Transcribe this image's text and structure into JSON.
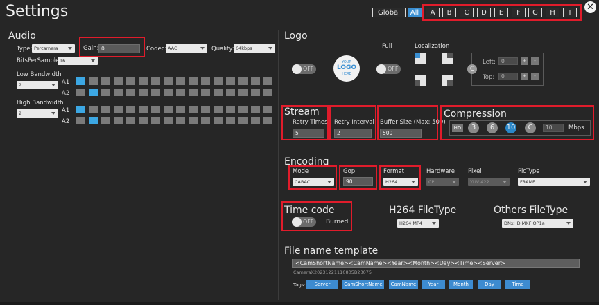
{
  "window": {
    "title": "Settings",
    "close_label": "✕"
  },
  "scope_tabs": {
    "global": "Global",
    "all": "All",
    "cameras": [
      "A",
      "B",
      "C",
      "D",
      "E",
      "F",
      "G",
      "H",
      "I"
    ]
  },
  "audio": {
    "section_title": "Audio",
    "type_label": "Type:",
    "type_value": "Percamera",
    "gain_label": "Gain:",
    "gain_value": "0",
    "codec_label": "Codec:",
    "codec_value": "AAC",
    "quality_label": "Quality:",
    "quality_value": "64kbps",
    "bps_label": "BitsPerSample:",
    "bps_value": "16",
    "low_bw_label": "Low Bandwidth",
    "low_bw_value": "2",
    "high_bw_label": "High Bandwidth",
    "high_bw_value": "2",
    "row_a1": "A1",
    "row_a2": "A2",
    "low_a1_on": 0,
    "low_a2_on": 1,
    "high_a1_on": 0,
    "high_a2_on": 1
  },
  "logo": {
    "section_title": "Logo",
    "toggle_state": "OFF",
    "placeholder_lines": [
      "YOUR",
      "LOGO",
      "HERE"
    ],
    "full_label": "Full",
    "full_state": "OFF",
    "localization_label": "Localization",
    "left_label": "Left:",
    "left_value": "0",
    "top_label": "Top:",
    "top_value": "0",
    "c_label": "C"
  },
  "stream": {
    "section_title": "Stream",
    "retry_times_label": "Retry Times",
    "retry_times_value": "5",
    "retry_interval_label": "Retry Interval",
    "retry_interval_value": "2",
    "buffer_label": "Buffer Size (Max: 500)",
    "buffer_value": "500"
  },
  "compression": {
    "section_title": "Compression",
    "hd_label": "HD",
    "options": [
      "3",
      "6",
      "10"
    ],
    "selected": "10",
    "custom_label": "C",
    "value": "10",
    "unit": "Mbps"
  },
  "encoding": {
    "section_title": "Encoding",
    "mode_label": "Mode",
    "mode_value": "CABAC",
    "gop_label": "Gop",
    "gop_value": "90",
    "format_label": "Format",
    "format_value": "H264",
    "hardware_label": "Hardware",
    "hardware_value": "CPU",
    "pixel_label": "Pixel",
    "pixel_value": "YUV 422",
    "pictype_label": "PicType",
    "pictype_value": "FRAME"
  },
  "timecode": {
    "section_title": "Time code",
    "state": "OFF",
    "burned_label": "Burned"
  },
  "filetype": {
    "h264_title": "H264 FileType",
    "h264_value": "H264 MP4",
    "others_title": "Others FileType",
    "others_value": "DNxHD MXF OP1a"
  },
  "filename": {
    "section_title": "File name template",
    "template": "<CamShortName><CamName><Year><Month><Day><Time><Server>",
    "preview": "CameraX20231221110805B23075",
    "tags_label": "Tags:",
    "tags": [
      "Server",
      "CamShortName",
      "CamName",
      "Year",
      "Month",
      "Day",
      "Time"
    ]
  }
}
